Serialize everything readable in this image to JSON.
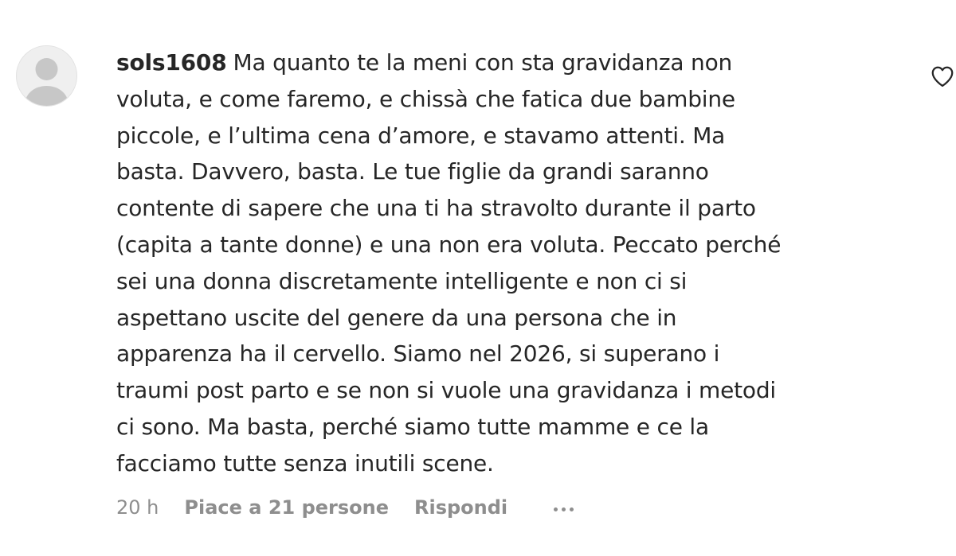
{
  "comment": {
    "username": "sols1608",
    "text_lines": [
      "Ma quanto te la meni con sta gravidanza non",
      "voluta, e come faremo, e chissà che fatica due bambine",
      "piccole, e l’ultima cena d’amore, e stavamo attenti. Ma",
      "basta. Davvero, basta. Le tue figlie da grandi saranno",
      "contente di sapere che una ti ha stravolto durante il parto",
      "(capita a tante donne) e una non era voluta. Peccato perché",
      "sei una donna discretamente intelligente e non ci si",
      "aspettano uscite del genere da una persona che in",
      "apparenza ha il cervello. Siamo nel 2026, si superano i",
      "traumi post parto e se non si vuole una gravidanza i metodi",
      "ci sono. Ma basta, perché siamo tutte mamme e ce la",
      "facciamo tutte senza inutili scene."
    ],
    "time": "20 h",
    "likes_label": "Piace a 21 persone",
    "reply_label": "Rispondi"
  },
  "icons": {
    "avatar": "default-avatar-icon",
    "like": "heart-outline-icon",
    "more": "more-options-icon"
  },
  "colors": {
    "text": "#262626",
    "secondary_text": "#8e8e8e",
    "avatar_bg": "#efefef",
    "avatar_figure": "#c7c7c7"
  }
}
